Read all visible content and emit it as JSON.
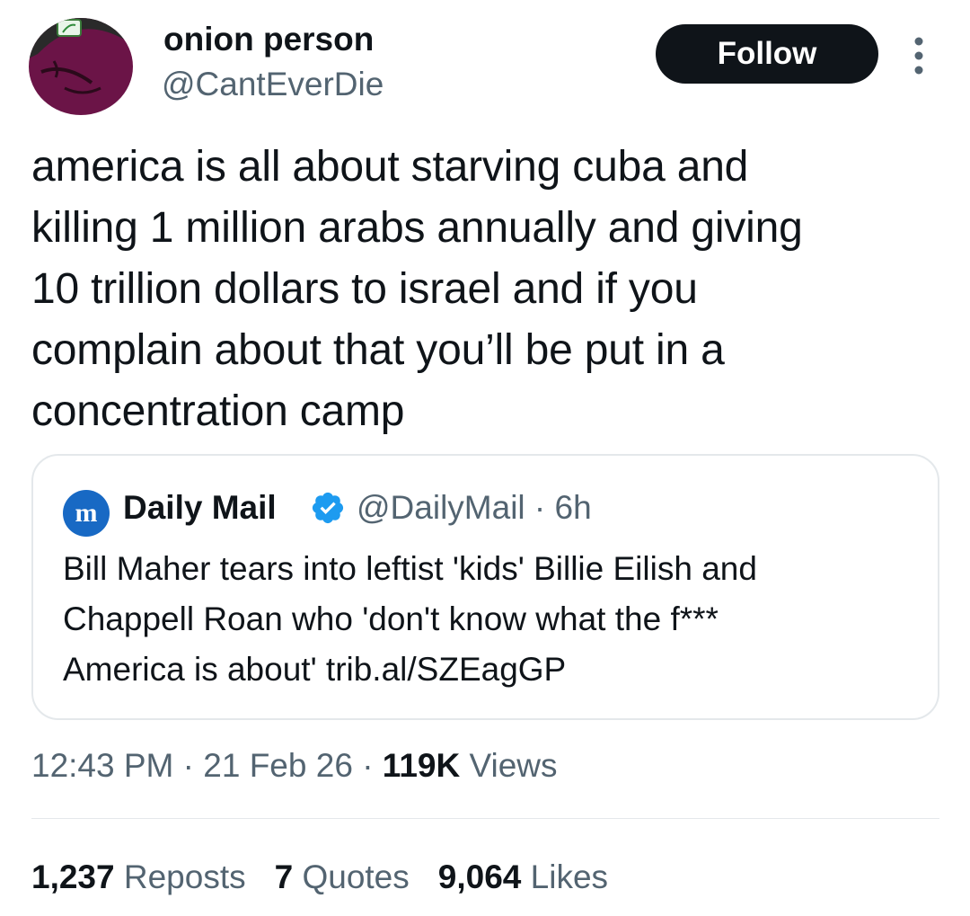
{
  "author": {
    "name": "onion person",
    "handle": "@CantEverDie"
  },
  "follow_label": "Follow",
  "tweet": {
    "lines": [
      "america is all about starving cuba and",
      "killing 1 million arabs annually and giving",
      "10 trillion dollars to israel and if you",
      "complain about that you’ll be put in a",
      "concentration camp"
    ]
  },
  "quote": {
    "logo_letter": "m",
    "name": "Daily Mail",
    "handle": "@DailyMail",
    "separator": "·",
    "time": "6h",
    "lines": [
      "Bill Maher tears into leftist 'kids' Billie Eilish and",
      "Chappell Roan who 'don't know what the f***",
      "America is about' trib.al/SZEagGP"
    ]
  },
  "meta": {
    "time": "12:43 PM",
    "date": "21 Feb 26",
    "separator": "·",
    "views_count": "119K",
    "views_label": "Views"
  },
  "stats": {
    "reposts_count": "1,237",
    "reposts_label": "Reposts",
    "quotes_count": "7",
    "quotes_label": "Quotes",
    "likes_count": "9,064",
    "likes_label": "Likes"
  },
  "colors": {
    "text": "#0f1419",
    "secondary": "#536471",
    "verified": "#1d9bf0",
    "border": "#e4e8eb",
    "avatar_bg": "#6b1447"
  },
  "icons": {
    "more": "more-vertical-icon",
    "verified": "verified-badge-icon",
    "source_logo": "daily-mail-logo-icon"
  }
}
